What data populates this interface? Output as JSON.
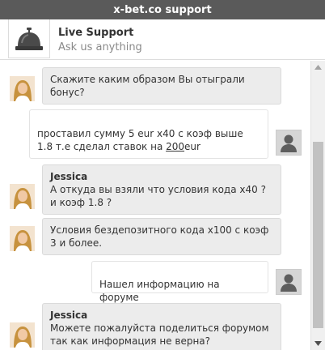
{
  "window": {
    "title": "x-bet.co support"
  },
  "header": {
    "logo_icon": "reception-bell-icon",
    "title": "Live Support",
    "subtitle": "Ask us anything"
  },
  "messages": [
    {
      "from": "agent",
      "name": "",
      "text": "Скажите каким образом Вы отыграли бонус?"
    },
    {
      "from": "user",
      "text_before": "проставил   сумму 5 eur x40 с коэф выше 1.8 т.е сделал   ставок на ",
      "amount": "200",
      "text_after": "eur"
    },
    {
      "from": "agent",
      "name": "Jessica",
      "text": "А откуда вы взяли что условия кода x40 ? и коэф 1.8 ?"
    },
    {
      "from": "agent",
      "name": "",
      "text": "Условия бездепозитного кода x100 с коэф 3 и более."
    },
    {
      "from": "user",
      "text": "Нашел информацию на форуме"
    },
    {
      "from": "agent",
      "name": "Jessica",
      "text": "Можете пожалуйста поделиться форумом так как информация не верна?"
    }
  ],
  "colors": {
    "titlebar_bg": "#5a5a5a",
    "agent_bubble_bg": "#ececec",
    "user_bubble_bg": "#ffffff",
    "scroll_thumb": "#c1c1c1"
  }
}
